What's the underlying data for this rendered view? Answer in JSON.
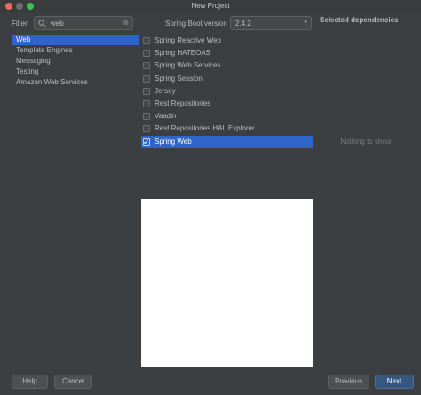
{
  "window": {
    "title": "New Project"
  },
  "filter": {
    "label": "Filter",
    "value": "web"
  },
  "categories": [
    {
      "label": "Web",
      "selected": true
    },
    {
      "label": "Template Engines",
      "selected": false
    },
    {
      "label": "Messaging",
      "selected": false
    },
    {
      "label": "Testing",
      "selected": false
    },
    {
      "label": "Amazon Web Services",
      "selected": false
    }
  ],
  "boot": {
    "label": "Spring Boot version",
    "value": "2.4.2"
  },
  "dependencies": [
    {
      "label": "Spring Reactive Web",
      "checked": false
    },
    {
      "label": "Spring HATEOAS",
      "checked": false
    },
    {
      "label": "Spring Web Services",
      "checked": false
    },
    {
      "label": "Spring Session",
      "checked": false
    },
    {
      "label": "Jersey",
      "checked": false
    },
    {
      "label": "Rest Repositories",
      "checked": false
    },
    {
      "label": "Vaadin",
      "checked": false
    },
    {
      "label": "Rest Repositories HAL Explorer",
      "checked": false
    },
    {
      "label": "Spring Web",
      "checked": true
    }
  ],
  "selected_panel": {
    "header": "Selected dependencies",
    "empty_text": "Nothing to show"
  },
  "buttons": {
    "help": "Help",
    "cancel": "Cancel",
    "previous": "Previous",
    "next": "Next"
  },
  "colors": {
    "background": "#3c3f41",
    "selection": "#2f65ca",
    "primary_button": "#365880"
  }
}
